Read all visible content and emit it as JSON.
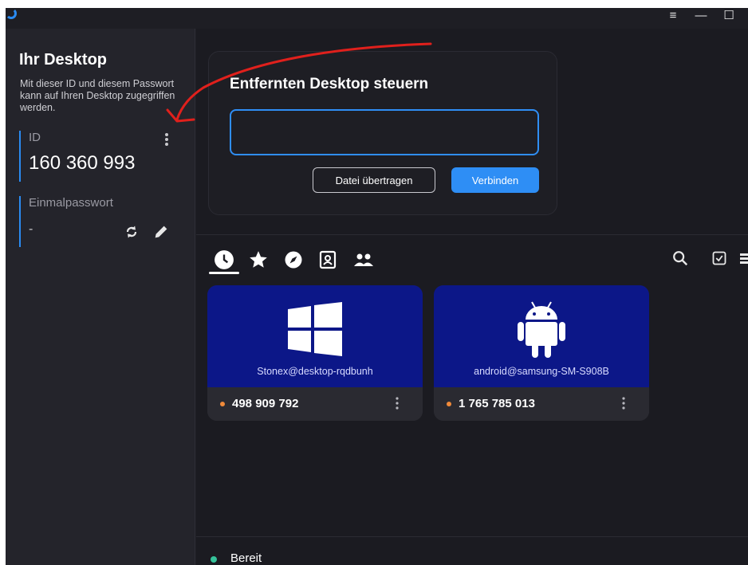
{
  "colors": {
    "accent": "#2e8ef5",
    "peer_card": "#0c1788",
    "status_ok": "#35c29a",
    "offline_dot": "#f08a3a",
    "annotation": "#e0201c"
  },
  "window_controls": {
    "menu": "≡",
    "minimize": "—",
    "maximize": "☐"
  },
  "sidebar": {
    "title": "Ihr Desktop",
    "description": "Mit dieser ID und diesem Passwort kann auf Ihren Desktop zugegriffen werden.",
    "id_label": "ID",
    "id_value": "160 360 993",
    "password_label": "Einmalpasswort",
    "password_value": "-",
    "icons": [
      "more-vert-icon",
      "refresh-icon",
      "edit-icon"
    ]
  },
  "connect": {
    "title": "Entfernten Desktop steuern",
    "input_value": "",
    "transfer_label": "Datei übertragen",
    "connect_label": "Verbinden"
  },
  "tabs": [
    "recent-icon",
    "favorites-icon",
    "discovered-icon",
    "address-book-icon",
    "group-icon"
  ],
  "tools": [
    "search-icon",
    "select-icon",
    "list-view-icon"
  ],
  "peers": [
    {
      "os": "windows-logo-icon",
      "name": "Stonex@desktop-rqdbunh",
      "id": "498 909 792"
    },
    {
      "os": "android-logo-icon",
      "name": "android@samsung-SM-S908B",
      "id": "1 765 785 013"
    }
  ],
  "status": {
    "text": "Bereit"
  }
}
